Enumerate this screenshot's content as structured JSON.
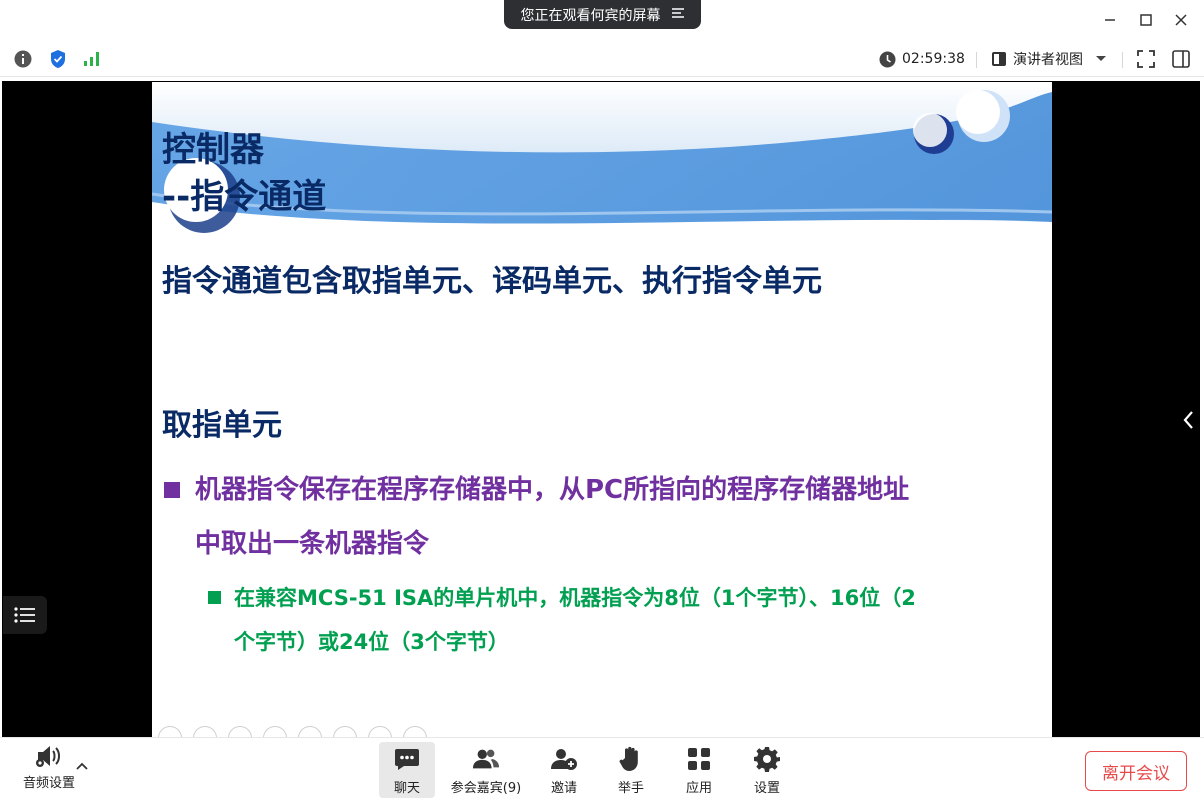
{
  "window": {
    "share_banner": "您正在观看何宾的屏幕"
  },
  "toolbar": {
    "timer": "02:59:38",
    "view_mode": "演讲者视图"
  },
  "slide": {
    "title_line1": "控制器",
    "title_line2": "--指令通道",
    "heading": "指令通道包含取指单元、译码单元、执行指令单元",
    "section": "取指单元",
    "bullet1_line1": "机器指令保存在程序存储器中，从PC所指向的程序存储器地址",
    "bullet1_line2": "中取出一条机器指令",
    "bullet2_line1": "在兼容MCS-51 ISA的单片机中，机器指令为8位（1个字节）、16位（2",
    "bullet2_line2": "个字节）或24位（3个字节）",
    "colors": {
      "title": "#0a2a66",
      "level1": "#7030a0",
      "level2": "#00a050"
    }
  },
  "bottombar": {
    "audio_label": "音频设置",
    "chat": "聊天",
    "participants": "参会嘉宾(9)",
    "invite": "邀请",
    "raise_hand": "举手",
    "apps": "应用",
    "settings": "设置",
    "leave": "离开会议"
  }
}
